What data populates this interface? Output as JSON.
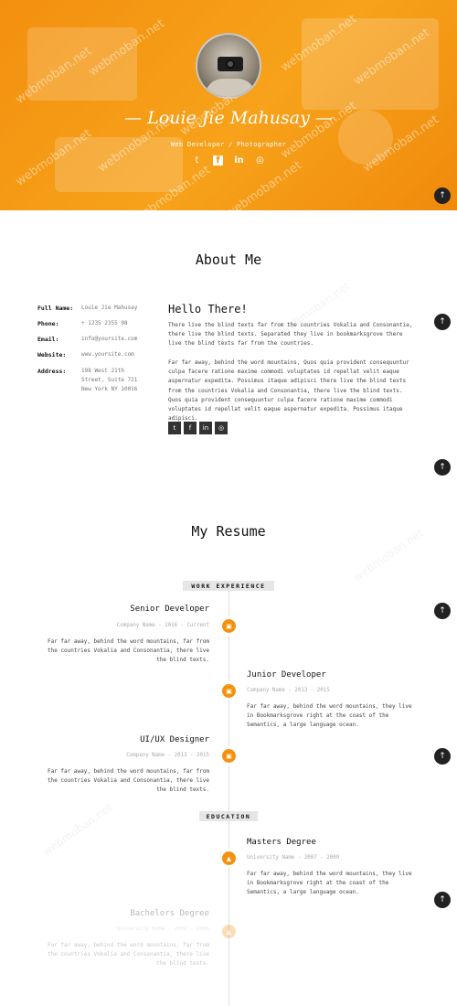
{
  "hero": {
    "name": "— Louie Jie Mahusay —",
    "role": "Web Developer / Photographer",
    "social_icons": [
      "twitter-icon",
      "facebook-icon",
      "linkedin-icon",
      "dribbble-icon"
    ],
    "accent_color": "#f39211"
  },
  "watermark_text": "webmoban.net",
  "about": {
    "title": "About Me",
    "info": [
      {
        "label": "Full Name:",
        "value": "Louie Jie Mahusay"
      },
      {
        "label": "Phone:",
        "value": "+ 1235 2355 98"
      },
      {
        "label": "Email:",
        "value": "info@yoursite.com"
      },
      {
        "label": "Website:",
        "value": "www.yoursite.com"
      },
      {
        "label": "Address:",
        "value": "198 West 21th Street, Suite 721 New York NY 10016"
      }
    ],
    "heading": "Hello There!",
    "paragraph1": "There live the blind texts far from the countries Vokalia and Consonantia, there live the blind texts. Separated they live in bookmarksgrove there live the blind texts far from the countries.",
    "paragraph2": "Far far away, behind the word mountains, Quos quia provident consequuntur culpa facere ratione maxime commodi voluptates id repellat velit eaque aspernatur expedita. Possimus itaque adipisci there live the blind texts from the countries Vokalia and Consonantia, there live the blind texts. Quos quia provident consequuntur culpa facere ratione maxime commodi voluptates id repellat velit eaque aspernatur expedita. Possimus itaque adipisci.",
    "social_icons": [
      "twitter-icon",
      "facebook-icon",
      "linkedin-icon",
      "dribbble-icon"
    ]
  },
  "resume": {
    "title": "My Resume",
    "work_tag": "WORK EXPERIENCE",
    "education_tag": "EDUCATION",
    "jobs": [
      {
        "title": "Senior Developer",
        "meta": "Company Name - 2016 - Current",
        "text": "Far far away, behind the word mountains, far from the countries Vokalia and Consonantia, there live the blind texts."
      },
      {
        "title": "Junior Developer",
        "meta": "Company Name - 2013 - 2015",
        "text": "Far far away, behind the word mountains, they live in Bookmarksgrove right at the coast of the Semantics, a large language ocean."
      },
      {
        "title": "UI/UX Designer",
        "meta": "Company Name - 2013 - 2015",
        "text": "Far far away, behind the word mountains, far from the countries Vokalia and Consonantia, there live the blind texts."
      }
    ],
    "education": [
      {
        "title": "Masters Degree",
        "meta": "University Name - 2007 - 2009",
        "text": "Far far away, behind the word mountains, they live in Bookmarksgrove right at the coast of the Semantics, a large language ocean."
      },
      {
        "title": "Bachelors Degree",
        "meta": "University Name - 2002 - 2006",
        "text": "Far far away, behind the word mountains, far from the countries Vokalia and Consonantia, there live the blind texts."
      }
    ]
  },
  "scroll_top_icon": "arrow-up-icon"
}
